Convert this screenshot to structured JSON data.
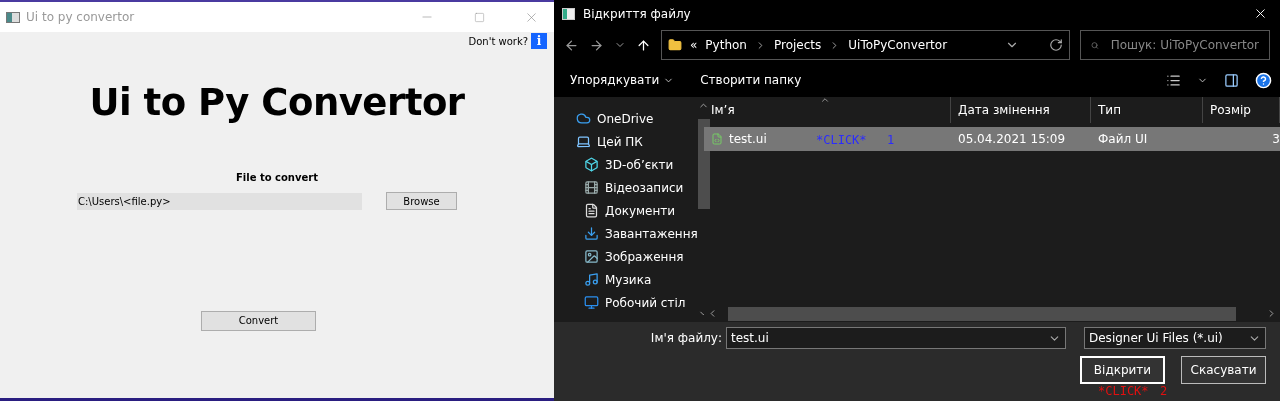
{
  "app_window": {
    "title": "Ui to py convertor",
    "help_label": "Don't work?",
    "help_button": "i",
    "heading": "Ui to Py Convertor",
    "file_label": "File to convert",
    "file_path": "C:\\Users\\<file.py>",
    "browse_button": "Browse",
    "convert_button": "Convert"
  },
  "file_dialog": {
    "title": "Відкриття файлу",
    "overflow": "«",
    "breadcrumb": [
      "Python",
      "Projects",
      "UiToPyConvertor"
    ],
    "search": {
      "placeholder": "Пошук: UiToPyConvertor"
    },
    "toolbar": [
      {
        "label": "Упорядкувати",
        "kind": "menu"
      },
      {
        "label": "Створити папку",
        "kind": "plain"
      }
    ],
    "sidebar": {
      "items": [
        {
          "label": "OneDrive",
          "kind": "cloud"
        },
        {
          "label": "Цей ПК",
          "kind": "pc",
          "children": [
            {
              "label": "3D-об’єкти",
              "kind": "cube"
            },
            {
              "label": "Відеозаписи",
              "kind": "film"
            },
            {
              "label": "Документи",
              "kind": "document"
            },
            {
              "label": "Завантаження",
              "kind": "download"
            },
            {
              "label": "Зображення",
              "kind": "picture"
            },
            {
              "label": "Музика",
              "kind": "music"
            },
            {
              "label": "Робочий стіл",
              "kind": "desktop"
            }
          ]
        }
      ]
    },
    "table": {
      "columns": [
        "Ім’я",
        "Дата змінення",
        "Тип",
        "Розмір"
      ],
      "rows": [
        {
          "name": "test.ui",
          "modified": "05.04.2021 15:09",
          "type": "Файл UI",
          "size": "3",
          "selected": true,
          "annotations": [
            {
              "text": "*CLICK*",
              "color": "#2b2bff"
            },
            {
              "text": "1",
              "color": "#2b2bff"
            }
          ]
        }
      ]
    },
    "filename_label": "Ім'я файлу:",
    "filename_value": "test.ui",
    "filter": "Designer Ui Files (*.ui)",
    "buttons": [
      {
        "label": "Відкрити",
        "focused": true,
        "annotations": [
          {
            "text": "*CLICK*",
            "color": "#e01010"
          },
          {
            "text": "2",
            "color": "#e01010"
          }
        ]
      },
      {
        "label": "Скасувати",
        "focused": false
      }
    ]
  }
}
